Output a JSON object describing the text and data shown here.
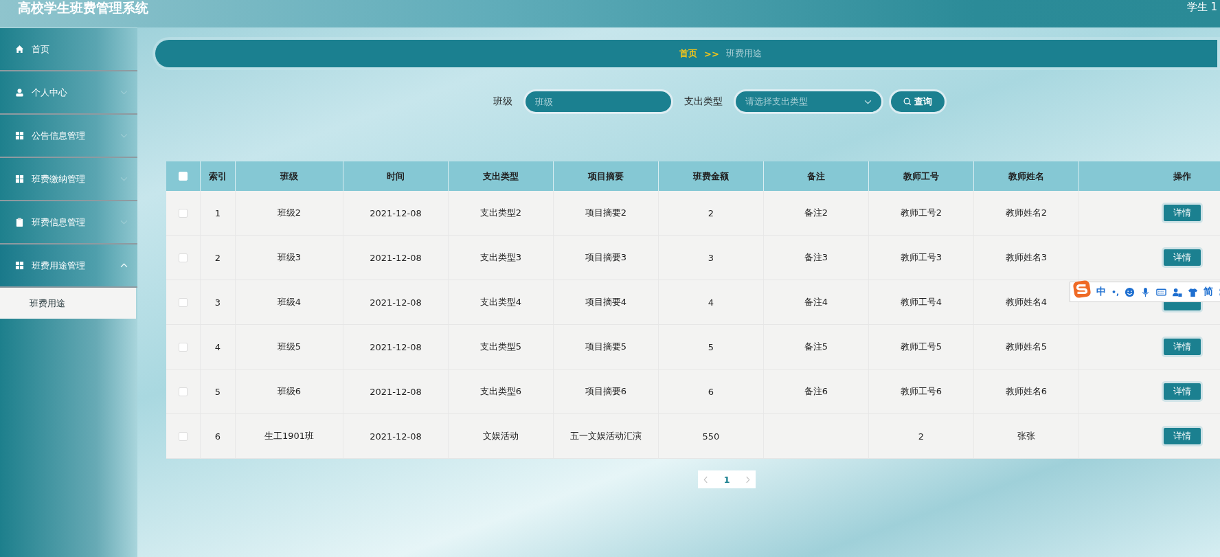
{
  "header": {
    "title": "高校学生班费管理系统",
    "user": "学生 1"
  },
  "sidebar": {
    "items": [
      {
        "label": "首页"
      },
      {
        "label": "个人中心",
        "expanded": false
      },
      {
        "label": "公告信息管理",
        "expanded": false
      },
      {
        "label": "班费缴纳管理",
        "expanded": false
      },
      {
        "label": "班费信息管理",
        "expanded": false
      },
      {
        "label": "班费用途管理",
        "expanded": true,
        "children": [
          {
            "label": "班费用途",
            "selected": true
          }
        ]
      }
    ]
  },
  "breadcrumb": {
    "home": "首页",
    "separator": ">>",
    "current": "班费用途"
  },
  "search": {
    "class_label": "班级",
    "class_placeholder": "班级",
    "type_label": "支出类型",
    "type_placeholder": "请选择支出类型",
    "button": "查询"
  },
  "table": {
    "select_all_checked": false,
    "columns": [
      "索引",
      "班级",
      "时间",
      "支出类型",
      "项目摘要",
      "班费金额",
      "备注",
      "教师工号",
      "教师姓名",
      "操作"
    ],
    "rows": [
      {
        "checked": false,
        "cells": [
          "1",
          "班级2",
          "2021-12-08",
          "支出类型2",
          "项目摘要2",
          "2",
          "备注2",
          "教师工号2",
          "教师姓名2"
        ],
        "action": "详情"
      },
      {
        "checked": false,
        "cells": [
          "2",
          "班级3",
          "2021-12-08",
          "支出类型3",
          "项目摘要3",
          "3",
          "备注3",
          "教师工号3",
          "教师姓名3"
        ],
        "action": "详情"
      },
      {
        "checked": false,
        "cells": [
          "3",
          "班级4",
          "2021-12-08",
          "支出类型4",
          "项目摘要4",
          "4",
          "备注4",
          "教师工号4",
          "教师姓名4"
        ]
      },
      {
        "checked": false,
        "cells": [
          "4",
          "班级5",
          "2021-12-08",
          "支出类型5",
          "项目摘要5",
          "5",
          "备注5",
          "教师工号5",
          "教师姓名5"
        ],
        "action": "详情"
      },
      {
        "checked": false,
        "cells": [
          "5",
          "班级6",
          "2021-12-08",
          "支出类型6",
          "项目摘要6",
          "6",
          "备注6",
          "教师工号6",
          "教师姓名6"
        ],
        "action": "详情"
      },
      {
        "checked": false,
        "cells": [
          "6",
          "生工1901班",
          "2021-12-08",
          "文娱活动",
          "五一文娱活动汇演",
          "550",
          "",
          "2",
          "张张"
        ],
        "action": "详情"
      }
    ]
  },
  "pagination": {
    "pages": [
      {
        "label": "1",
        "selected": true
      }
    ]
  },
  "ime_toolbar": {
    "mode": "中",
    "punct": "•,",
    "script": "简"
  }
}
